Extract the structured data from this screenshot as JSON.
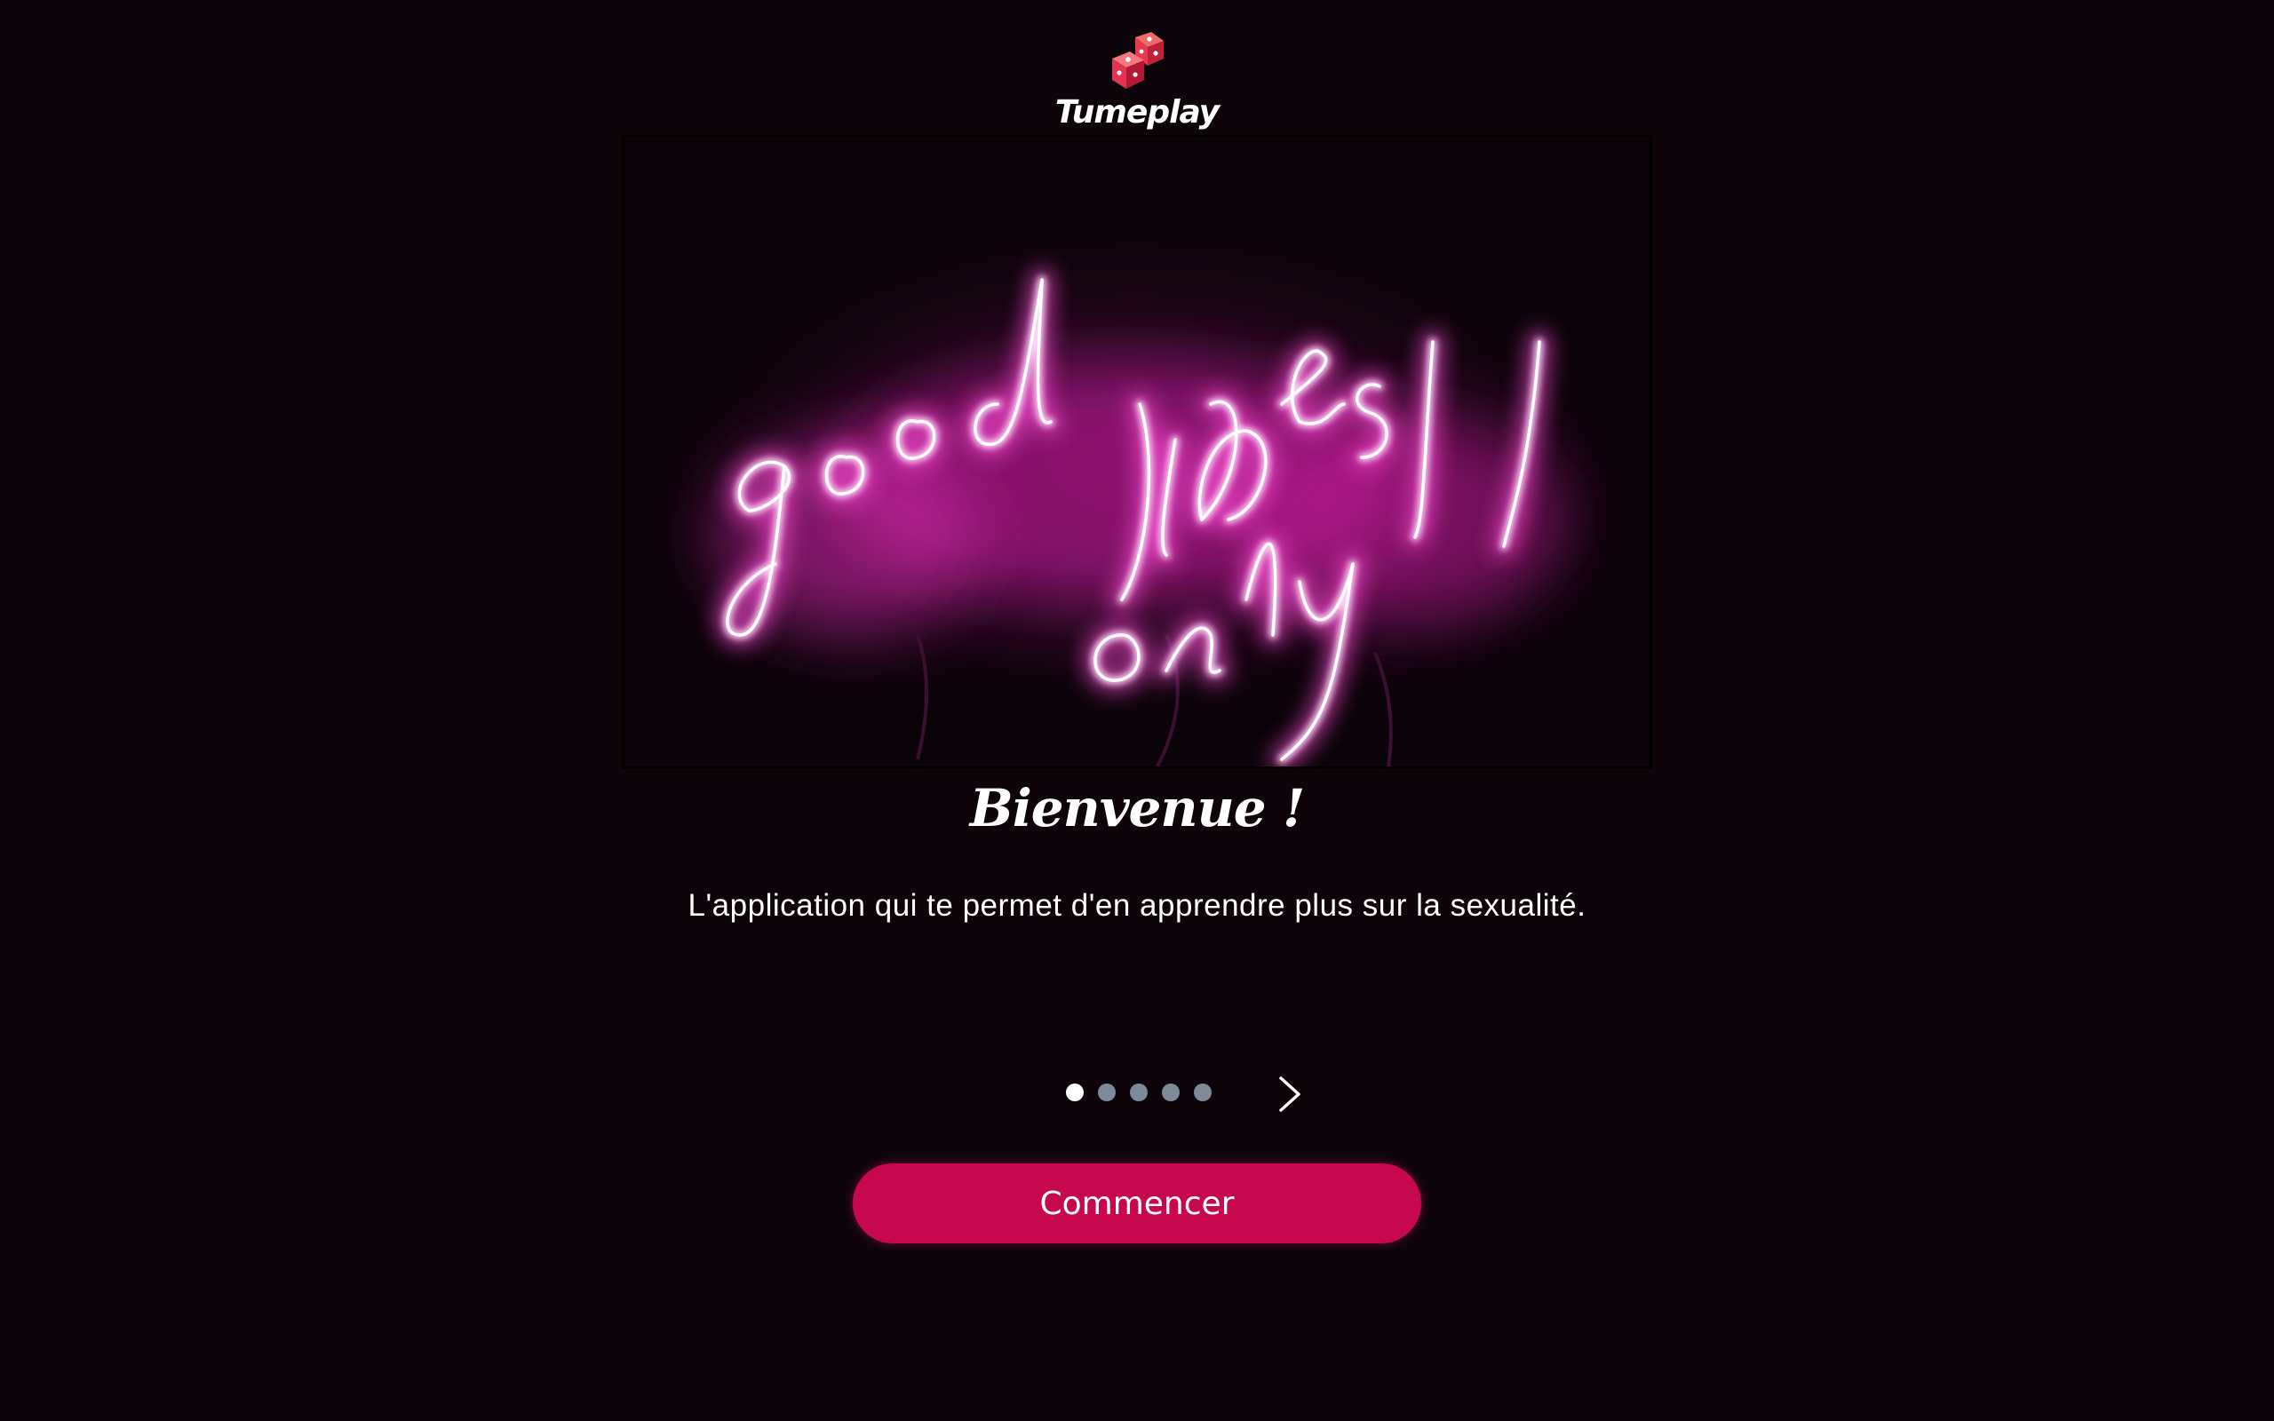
{
  "app": {
    "logo_text": "Tumeplay",
    "logo_icon": "dice-icon"
  },
  "hero": {
    "image": "neon-sign-image",
    "neon_text": "good vibes only",
    "neon_color": "#ff4fd8"
  },
  "main": {
    "title": "Bienvenue !",
    "description": "L'application qui te permet d'en apprendre plus sur la sexualité."
  },
  "pager": {
    "total": 5,
    "current": 1,
    "next_icon": "chevron-right-icon"
  },
  "cta": {
    "label": "Commencer"
  },
  "colors": {
    "background": "#0e050b",
    "accent": "#c8084e",
    "dot_inactive": "#7f8a99",
    "dot_active": "#ffffff"
  }
}
